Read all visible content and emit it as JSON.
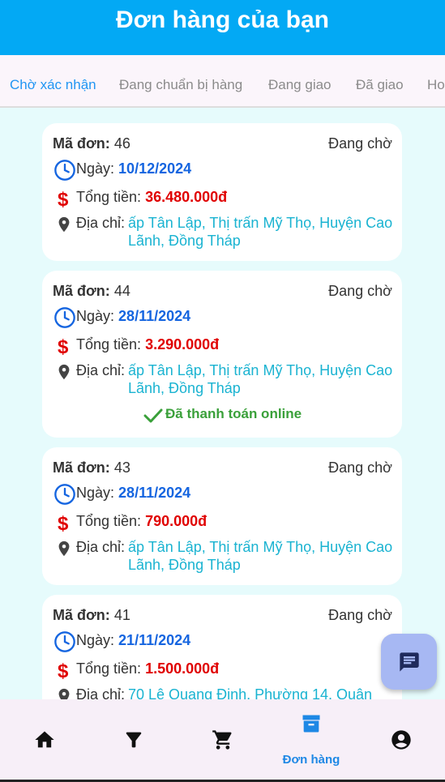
{
  "header": {
    "title": "Đơn hàng của bạn"
  },
  "tabs": [
    {
      "label": "Chờ xác nhận",
      "active": true
    },
    {
      "label": "Đang chuẩn bị hàng",
      "active": false
    },
    {
      "label": "Đang giao",
      "active": false
    },
    {
      "label": "Đã giao",
      "active": false
    },
    {
      "label": "Ho",
      "active": false
    }
  ],
  "labels": {
    "order_id": "Mã đơn:",
    "date": "Ngày:",
    "total": "Tổng tiền:",
    "address": "Địa chỉ:"
  },
  "orders": [
    {
      "id": "46",
      "status": "Đang chờ",
      "date": "10/12/2024",
      "total": "36.480.000đ",
      "address_line1": "ấp Tân Lập, Thị trấn Mỹ Thọ, Huyện Cao",
      "address_line2": "Lãnh, Đồng Tháp",
      "payment_note": ""
    },
    {
      "id": "44",
      "status": "Đang chờ",
      "date": "28/11/2024",
      "total": "3.290.000đ",
      "address_line1": "ấp Tân Lập, Thị trấn Mỹ Thọ, Huyện Cao",
      "address_line2": "Lãnh, Đồng Tháp",
      "payment_note": "Đã thanh toán online"
    },
    {
      "id": "43",
      "status": "Đang chờ",
      "date": "28/11/2024",
      "total": "790.000đ",
      "address_line1": "ấp Tân Lập, Thị trấn Mỹ Thọ, Huyện Cao",
      "address_line2": "Lãnh, Đồng Tháp",
      "payment_note": ""
    },
    {
      "id": "41",
      "status": "Đang chờ",
      "date": "21/11/2024",
      "total": "1.500.000đ",
      "address_line1": "70 Lê Quang Định, Phường 14, Quận",
      "address_line2": "",
      "payment_note": ""
    }
  ],
  "fab": {
    "icon": "chat-icon"
  },
  "bottom_nav": [
    {
      "icon": "home-icon",
      "label": ""
    },
    {
      "icon": "filter-icon",
      "label": ""
    },
    {
      "icon": "cart-icon",
      "label": ""
    },
    {
      "icon": "archive-icon",
      "label": "Đơn hàng",
      "active": true
    },
    {
      "icon": "account-icon",
      "label": ""
    }
  ],
  "colors": {
    "primary": "#03a9f4",
    "date": "#1565e0",
    "money": "#e00000",
    "address": "#1ab3d1",
    "paid": "#3aa03a",
    "background": "#e6fbfc"
  }
}
